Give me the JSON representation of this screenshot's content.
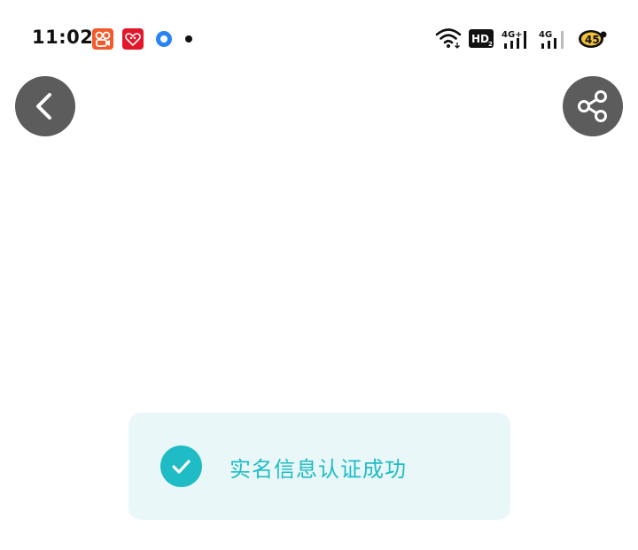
{
  "status_bar": {
    "time": "11:02",
    "icons": [
      "kuaishou-app-icon",
      "red-app-icon",
      "blue-circle-app-icon",
      "notification-dot",
      "wifi-icon",
      "hd-icon",
      "4g-plus-signal-icon",
      "4g-signal-icon",
      "battery-icon"
    ],
    "hd_label": "HD",
    "network_1": "4G+",
    "network_2": "4G",
    "battery_level": "45"
  },
  "nav": {
    "back_icon": "chevron-left-icon",
    "share_icon": "share-icon"
  },
  "toast": {
    "message": "实名信息认证成功",
    "icon": "check-icon",
    "accent_color": "#1fbcc6",
    "background_color": "#e9f7f8"
  }
}
